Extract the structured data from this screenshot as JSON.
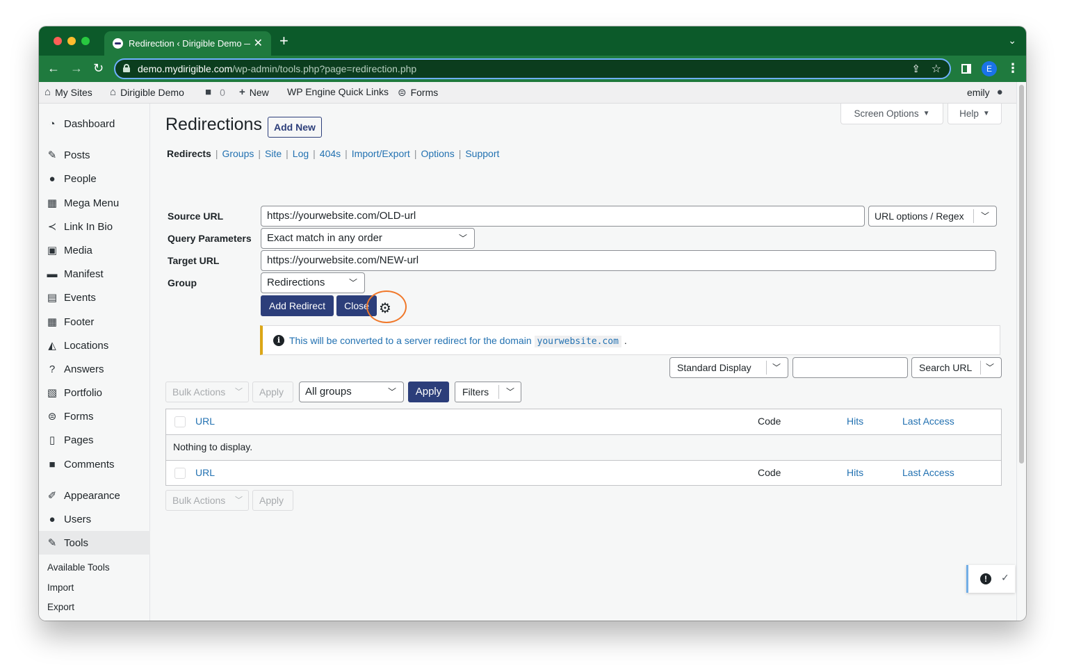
{
  "browser": {
    "tab_title": "Redirection ‹ Dirigible Demo —",
    "tab_close": "✕",
    "new_tab": "+",
    "tab_menu": "⌄",
    "url_host": "demo.mydirigible.com",
    "url_path": "/wp-admin/tools.php?page=redirection.php",
    "profile_initial": "E",
    "icons": [
      "back-arrow-icon",
      "forward-arrow-icon",
      "reload-icon",
      "lock-icon",
      "share-icon",
      "star-icon",
      "side-panel-icon",
      "kebab-menu-icon"
    ]
  },
  "adminbar": {
    "my_sites": "My Sites",
    "site_name": "Dirigible Demo",
    "comments_count": "0",
    "new": "New",
    "quick_links": "WP Engine Quick Links",
    "forms": "Forms",
    "user": "emily"
  },
  "sidebar": {
    "items": [
      {
        "label": "Dashboard",
        "icon": "dashboard-icon"
      },
      {
        "label": "Posts",
        "icon": "pin-icon"
      },
      {
        "label": "People",
        "icon": "person-icon"
      },
      {
        "label": "Mega Menu",
        "icon": "grid-icon"
      },
      {
        "label": "Link In Bio",
        "icon": "share-icon"
      },
      {
        "label": "Media",
        "icon": "media-icon"
      },
      {
        "label": "Manifest",
        "icon": "folder-icon"
      },
      {
        "label": "Events",
        "icon": "calendar-icon"
      },
      {
        "label": "Footer",
        "icon": "grid-icon"
      },
      {
        "label": "Locations",
        "icon": "location-icon"
      },
      {
        "label": "Answers",
        "icon": "question-icon"
      },
      {
        "label": "Portfolio",
        "icon": "portfolio-icon"
      },
      {
        "label": "Forms",
        "icon": "forms-icon"
      },
      {
        "label": "Pages",
        "icon": "pages-icon"
      },
      {
        "label": "Comments",
        "icon": "comment-icon"
      },
      {
        "label": "Appearance",
        "icon": "brush-icon"
      },
      {
        "label": "Users",
        "icon": "person-icon"
      },
      {
        "label": "Tools",
        "icon": "wrench-icon"
      }
    ],
    "submenu": [
      "Available Tools",
      "Import",
      "Export"
    ]
  },
  "main": {
    "screen_options": "Screen Options",
    "help": "Help",
    "title": "Redirections",
    "add_new": "Add New",
    "subnav": [
      "Redirects",
      "Groups",
      "Site",
      "Log",
      "404s",
      "Import/Export",
      "Options",
      "Support"
    ],
    "form": {
      "source_label": "Source URL",
      "source_value": "https://yourwebsite.com/OLD-url",
      "url_options": "URL options / Regex",
      "query_label": "Query Parameters",
      "query_value": "Exact match in any order",
      "target_label": "Target URL",
      "target_value": "https://yourwebsite.com/NEW-url",
      "group_label": "Group",
      "group_value": "Redirections",
      "add_redirect": "Add Redirect",
      "close": "Close"
    },
    "notice": {
      "text": "This will be converted to a server redirect for the domain",
      "domain": "yourwebsite.com",
      "end": "."
    },
    "display_select": "Standard Display",
    "search_value": "",
    "search_button": "Search URL",
    "bulk_actions": "Bulk Actions",
    "apply": "Apply",
    "group_filter": "All groups",
    "filters": "Filters",
    "table": {
      "columns": [
        "URL",
        "Code",
        "Hits",
        "Last Access"
      ],
      "empty": "Nothing to display."
    }
  },
  "colors": {
    "chrome_dark": "#0c5a2a",
    "chrome": "#1f7a3e",
    "primary": "#2c3e7a",
    "link": "#2271b1",
    "highlight": "#f0782a",
    "notice_border": "#dba617"
  }
}
